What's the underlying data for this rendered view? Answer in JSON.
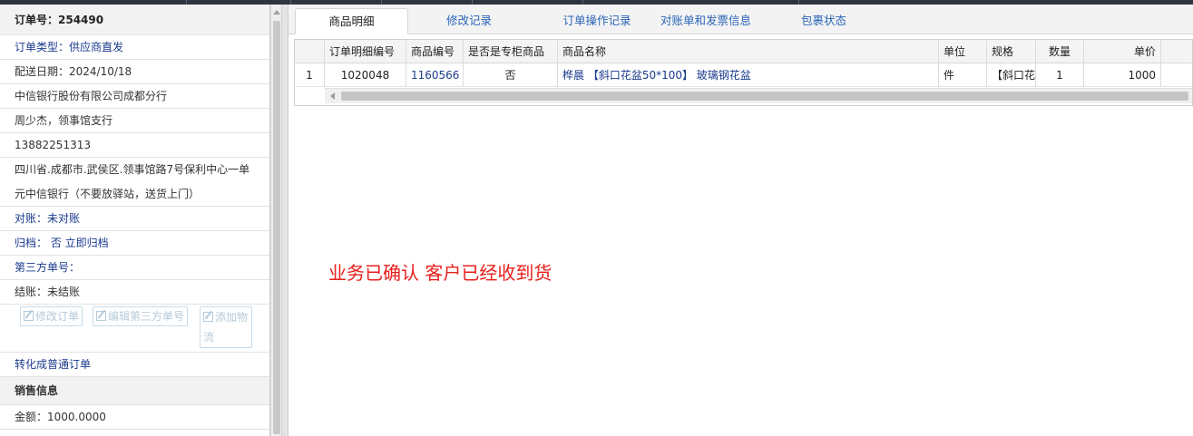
{
  "order": {
    "title": "订单号：254490",
    "type": "订单类型：供应商直发",
    "delivery_date": "配送日期：2024/10/18",
    "company": "中信银行股份有限公司成都分行",
    "contact": "周少杰，领事馆支行",
    "phone": "13882251313",
    "address": "四川省.成都市.武侯区.领事馆路7号保利中心一单元中信银行（不要放驿站，送货上门）",
    "reconcile": "对账：未对账",
    "archive": "归档：  否 立即归档",
    "third_party": "第三方单号：",
    "settlement": "结账：未结账",
    "buttons": {
      "edit_order": "修改订单",
      "edit_third": "编辑第三方单号",
      "add_logistics": "添加物流"
    },
    "convert": "转化成普通订单"
  },
  "sales": {
    "section_title": "销售信息",
    "amount": "金额：1000.0000"
  },
  "tabs": [
    "商品明细",
    "修改记录",
    "订单操作记录",
    "对账单和发票信息",
    "包裹状态"
  ],
  "table": {
    "headers": [
      "",
      "订单明细编号",
      "商品编号",
      "是否是专柜商品",
      "商品名称",
      "单位",
      "规格",
      "数量",
      "单价"
    ],
    "rows": [
      [
        "1",
        "1020048",
        "1160566",
        "否",
        "桦晨 【斜口花盆50*100】 玻璃钢花盆",
        "件",
        "【斜口花",
        "1",
        "1000"
      ]
    ]
  },
  "note": "业务已确认 客户已经收到货",
  "colors": {
    "link_blue": "#1a3a8c",
    "tab_blue": "#2a64b8",
    "note_red": "#e8201c"
  }
}
